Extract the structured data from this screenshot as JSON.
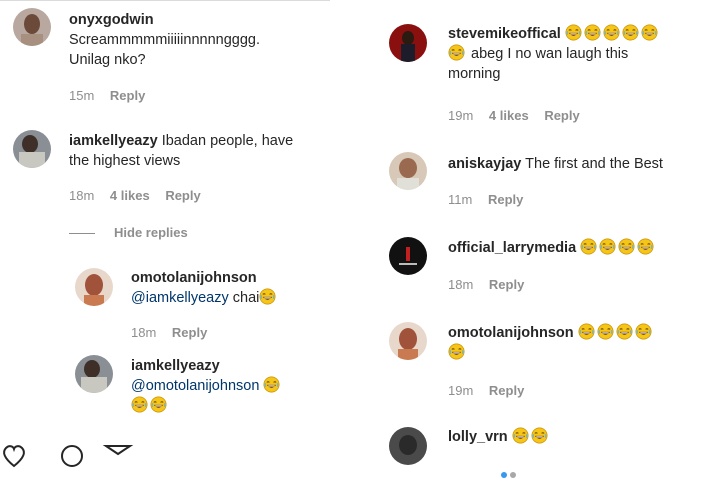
{
  "left": {
    "comments": [
      {
        "username": "onyxgodwin",
        "line1": "Screammmmmiiiiinnnnngggg.",
        "line2": "Unilag nko?",
        "time": "15m",
        "reply": "Reply"
      },
      {
        "username": "iamkellyeazy",
        "line1": " Ibadan people, have",
        "line2": "the highest views",
        "time": "18m",
        "likes": "4 likes",
        "reply": "Reply"
      }
    ],
    "hide_replies": "Hide replies",
    "replies": [
      {
        "username": "omotolanijohnson",
        "mention": "@iamkellyeazy",
        "text": " chai",
        "time": "18m",
        "reply": "Reply"
      },
      {
        "username": "iamkellyeazy",
        "mention": "@omotolanijohnson",
        "text": ""
      }
    ]
  },
  "right": {
    "comments": [
      {
        "username": "stevemikeoffical",
        "line2": " abeg I no wan laugh this",
        "line3": "morning",
        "time": "19m",
        "likes": "4 likes",
        "reply": "Reply"
      },
      {
        "username": "aniskayjay",
        "text": " The first and the Best",
        "time": "11m",
        "reply": "Reply"
      },
      {
        "username": "official_larrymedia",
        "time": "18m",
        "reply": "Reply"
      },
      {
        "username": "omotolanijohnson",
        "time": "19m",
        "reply": "Reply"
      },
      {
        "username": "lolly_vrn"
      }
    ]
  },
  "icons": [
    "heart-icon",
    "comment-icon",
    "share-icon",
    "laughing-emoji",
    "avatar-photo"
  ],
  "colors": {
    "text": "#262626",
    "meta": "#8e8e8e",
    "mention": "#00376b",
    "emoji": "#f5c518"
  }
}
